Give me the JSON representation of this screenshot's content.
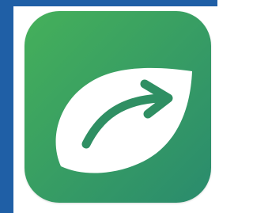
{
  "app_icon": {
    "icon": "leaf-arrow-icon",
    "gradient_start": "#3fae5a",
    "gradient_end": "#2b8a6e",
    "leaf_color": "#ffffff",
    "arrow_color": "#2f8f63"
  },
  "frame": {
    "edge_color": "#1f5fa6"
  }
}
